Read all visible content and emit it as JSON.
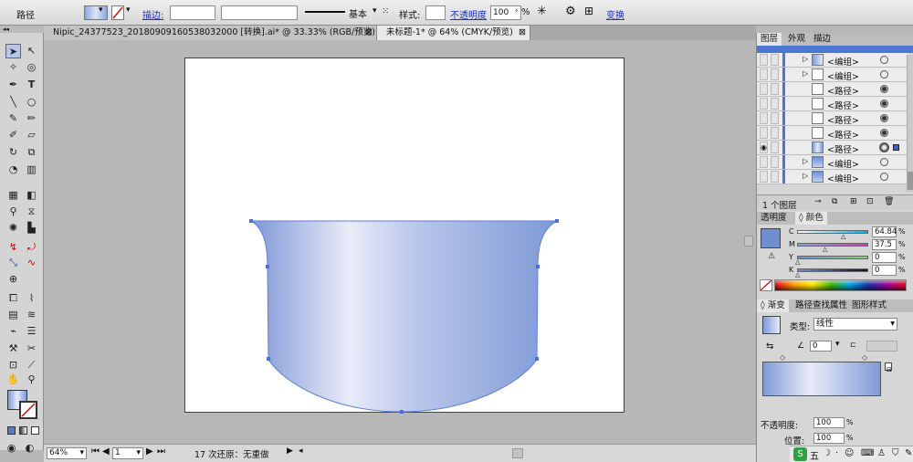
{
  "control_bar": {
    "mode_label": "路径",
    "stroke_label": "描边:",
    "stroke_style": "基本",
    "style_label": "样式:",
    "opacity_label": "不透明度",
    "opacity_value": "100",
    "opacity_unit": "%",
    "transform_label": "变换"
  },
  "tabs": [
    {
      "label": "Nipic_24377523_20180909160538032000 [转换].ai* @ 33.33% (RGB/预览)",
      "active": false
    },
    {
      "label": "未标题-1* @ 64% (CMYK/预览)",
      "active": true
    }
  ],
  "status_bar": {
    "zoom": "64%",
    "page": "1",
    "status_text": "17 次还原：无重做"
  },
  "layers_panel": {
    "tabs": [
      "图层",
      "外观",
      "描边"
    ],
    "rows": [
      {
        "name": "<编组>",
        "expandable": true,
        "target": "empty"
      },
      {
        "name": "<编组>",
        "expandable": true,
        "target": "empty"
      },
      {
        "name": "<路径>",
        "expandable": false,
        "target": "filled"
      },
      {
        "name": "<路径>",
        "expandable": false,
        "target": "filled"
      },
      {
        "name": "<路径>",
        "expandable": false,
        "target": "filled"
      },
      {
        "name": "<路径>",
        "expandable": false,
        "target": "filled"
      },
      {
        "name": "<路径>",
        "expandable": false,
        "target": "selected"
      },
      {
        "name": "<编组>",
        "expandable": true,
        "target": "empty"
      },
      {
        "name": "<编组>",
        "expandable": true,
        "target": "empty"
      }
    ],
    "footer": "1 个图层"
  },
  "color_panel": {
    "tabs": [
      "透明度",
      "颜色"
    ],
    "channels": [
      {
        "label": "C",
        "value": "64.84"
      },
      {
        "label": "M",
        "value": "37.5"
      },
      {
        "label": "Y",
        "value": "0"
      },
      {
        "label": "K",
        "value": "0"
      }
    ],
    "fill_color": "#6f8fd0"
  },
  "gradient_panel": {
    "tabs": [
      "渐变",
      "路径查找",
      "属性",
      "图形样式"
    ],
    "type_label": "类型:",
    "type_value": "线性",
    "angle": "0",
    "opacity_label": "不透明度:",
    "opacity_value": "100",
    "location_label": "位置:",
    "location_value": "100",
    "unit": "%"
  },
  "colors": {
    "gradient_dark": "#7f9ad8",
    "gradient_light": "#e8ebf8",
    "selection_blue": "#4a6fd8"
  }
}
